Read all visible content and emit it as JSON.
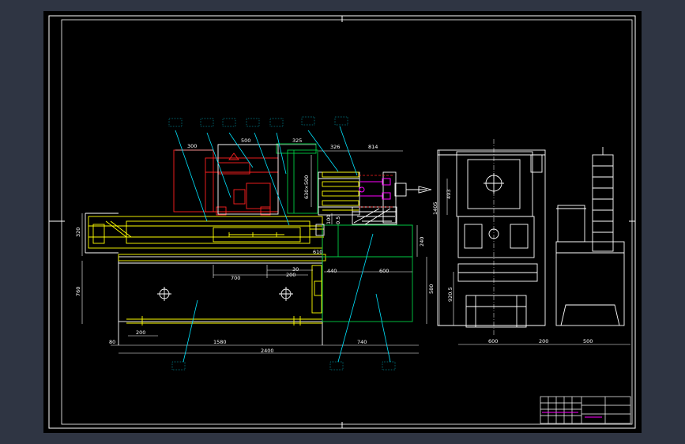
{
  "colors": {
    "background": "#2f3543",
    "sheet": "#000000",
    "frame": "#ffffff",
    "outline": "#ffffff",
    "machine_yellow": "#ffff00",
    "motor_red": "#ff2020",
    "base_green": "#00cc44",
    "leader_cyan": "#00e5ff",
    "magenta": "#ff00ff"
  },
  "dimensions": {
    "top": [
      "300",
      "500",
      "325",
      "326",
      "814"
    ],
    "left": [
      "320",
      "760"
    ],
    "center": [
      "610",
      "700",
      "200",
      "30",
      "440",
      "600"
    ],
    "bottom": [
      "80",
      "200",
      "1580",
      "2400",
      "740"
    ],
    "right_vertical": [
      "240",
      "580"
    ],
    "middle_vertical": [
      "100",
      "0.5",
      "630×500"
    ],
    "side_view": [
      "1405",
      "493",
      "920.5"
    ],
    "side_bottom": [
      "600",
      "200",
      "500"
    ]
  },
  "leader_labels": {
    "top": [
      "",
      "",
      "",
      "",
      "",
      "",
      ""
    ],
    "bottom": [
      "",
      "",
      ""
    ]
  },
  "title_block": {
    "cells": [
      "",
      "",
      "",
      ""
    ]
  }
}
